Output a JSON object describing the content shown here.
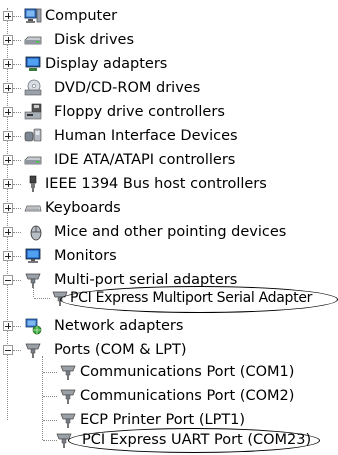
{
  "device_tree": {
    "categories": [
      {
        "label": "Computer",
        "icon": "computer-icon",
        "state": "collapsed"
      },
      {
        "label": "Disk drives",
        "icon": "disk-drive-icon",
        "state": "collapsed"
      },
      {
        "label": "Display adapters",
        "icon": "display-adapter-icon",
        "state": "collapsed"
      },
      {
        "label": "DVD/CD-ROM drives",
        "icon": "dvd-drive-icon",
        "state": "collapsed"
      },
      {
        "label": "Floppy drive controllers",
        "icon": "floppy-controller-icon",
        "state": "collapsed"
      },
      {
        "label": "Human Interface Devices",
        "icon": "hid-icon",
        "state": "collapsed"
      },
      {
        "label": "IDE ATA/ATAPI controllers",
        "icon": "ide-controller-icon",
        "state": "collapsed"
      },
      {
        "label": "IEEE 1394 Bus host controllers",
        "icon": "firewire-icon",
        "state": "collapsed"
      },
      {
        "label": "Keyboards",
        "icon": "keyboard-icon",
        "state": "collapsed"
      },
      {
        "label": "Mice and other pointing devices",
        "icon": "mouse-icon",
        "state": "collapsed"
      },
      {
        "label": "Monitors",
        "icon": "monitor-icon",
        "state": "collapsed"
      },
      {
        "label": "Multi-port serial adapters",
        "icon": "serial-port-icon",
        "state": "expanded",
        "children": [
          {
            "label": "PCI Express Multiport Serial Adapter",
            "icon": "serial-port-icon",
            "circled": true
          }
        ]
      },
      {
        "label": "Network adapters",
        "icon": "network-adapter-icon",
        "state": "collapsed"
      },
      {
        "label": "Ports (COM & LPT)",
        "icon": "serial-port-icon",
        "state": "expanded",
        "children": [
          {
            "label": "Communications Port (COM1)",
            "icon": "serial-port-icon"
          },
          {
            "label": "Communications Port (COM2)",
            "icon": "serial-port-icon"
          },
          {
            "label": "ECP Printer Port (LPT1)",
            "icon": "serial-port-icon"
          },
          {
            "label": "PCI Express UART Port (COM23)",
            "icon": "serial-port-icon",
            "circled": true
          }
        ]
      }
    ]
  }
}
